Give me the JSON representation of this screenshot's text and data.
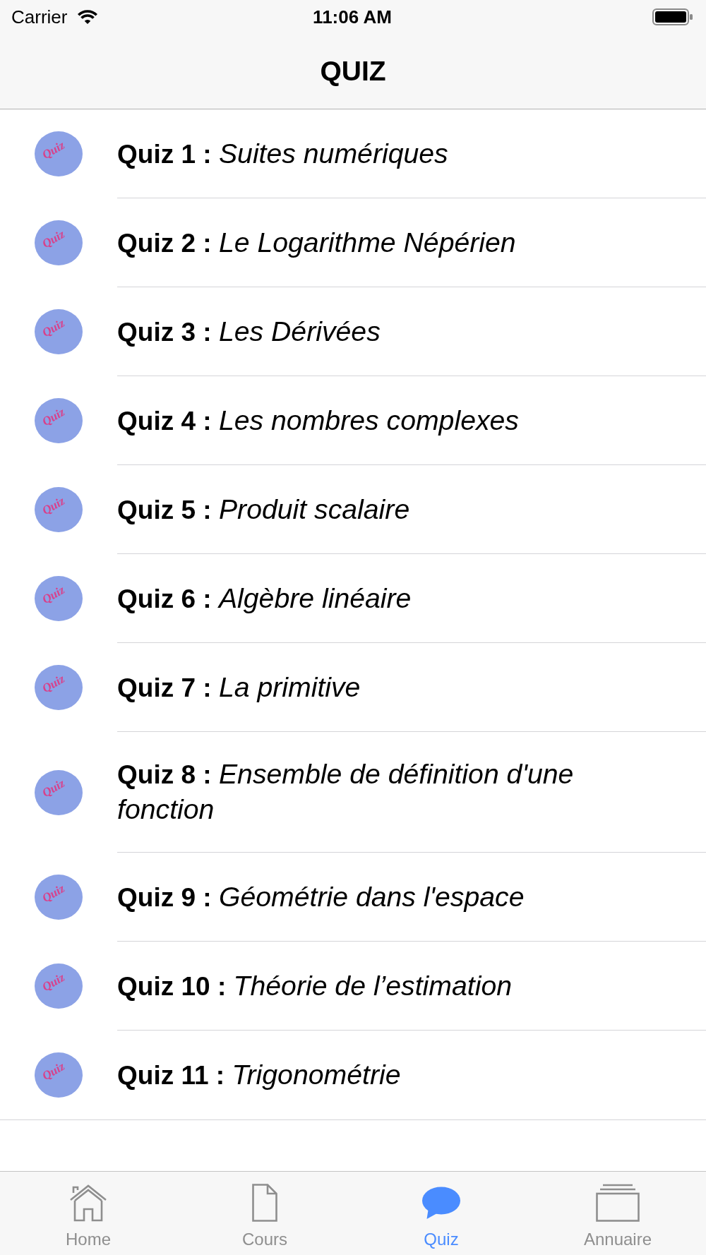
{
  "status_bar": {
    "carrier": "Carrier",
    "time": "11:06 AM"
  },
  "navigation_bar": {
    "title": "QUIZ"
  },
  "quizzes": [
    {
      "logo_text": "Quiz",
      "text": "**Quiz 1 :** *Suites numériques*"
    },
    {
      "logo_text": "Quiz",
      "text": "**Quiz 2 :** *Le Logarithme Népérien*"
    },
    {
      "logo_text": "Quiz",
      "text": "**Quiz 3 :** *Les Dérivées*"
    },
    {
      "logo_text": "Quiz",
      "text": "**Quiz 4 :** *Les nombres complexes*"
    },
    {
      "logo_text": "Quiz",
      "text": "**Quiz 5 :** *Produit scalaire*"
    },
    {
      "logo_text": "Quiz",
      "text": "**Quiz 6 :** *Algèbre linéaire*"
    },
    {
      "logo_text": "Quiz",
      "text": "**Quiz 7 :** *La primitive*"
    },
    {
      "logo_text": "Quiz",
      "text": "**Quiz 8 :** *Ensemble de définition d'une fonction*"
    },
    {
      "logo_text": "Quiz",
      "text": "**Quiz 9 :** *Géométrie dans l'espace*"
    },
    {
      "logo_text": "Quiz",
      "text": "**Quiz 10 :** *Théorie de l’estimation*"
    },
    {
      "logo_text": "Quiz",
      "text": "**Quiz 11 :** *Trigonométrie*"
    }
  ],
  "tab_bar": {
    "tabs": [
      {
        "label": "Home",
        "selected": false
      },
      {
        "label": "Cours",
        "selected": false
      },
      {
        "label": "Quiz",
        "selected": true
      },
      {
        "label": "Annuaire",
        "selected": false
      }
    ]
  }
}
